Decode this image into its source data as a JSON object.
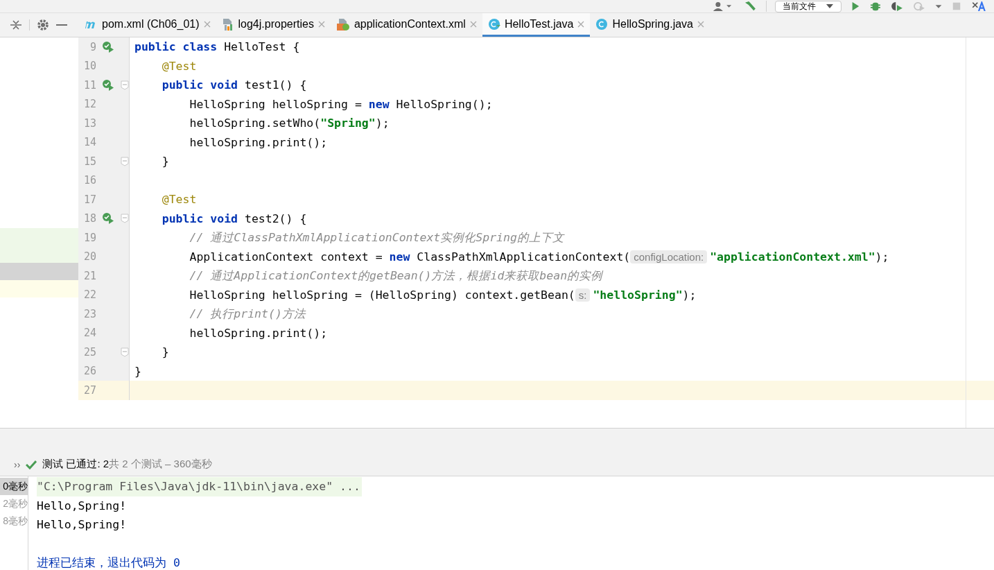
{
  "toolbar": {
    "run_config": "当前文件",
    "buttons": [
      {
        "kind": "user"
      },
      {
        "kind": "build"
      },
      {
        "kind": "config"
      },
      {
        "kind": "run",
        "disabled": false
      },
      {
        "kind": "debug",
        "disabled": false
      },
      {
        "kind": "coverage",
        "disabled": false
      },
      {
        "kind": "profile",
        "disabled": true
      },
      {
        "kind": "more"
      },
      {
        "kind": "stop",
        "disabled": true
      },
      {
        "kind": "translate"
      }
    ]
  },
  "tabs": [
    {
      "label": "pom.xml (Ch06_01)",
      "kind": "maven",
      "selected": false
    },
    {
      "label": "log4j.properties",
      "kind": "properties",
      "selected": false
    },
    {
      "label": "applicationContext.xml",
      "kind": "spring-xml",
      "selected": false
    },
    {
      "label": "HelloTest.java",
      "kind": "test-class",
      "selected": true
    },
    {
      "label": "HelloSpring.java",
      "kind": "class",
      "selected": false
    }
  ],
  "side_panel": {
    "rows": [
      {
        "kind": "passed"
      },
      {
        "kind": "passed"
      },
      {
        "kind": "selected"
      },
      {
        "kind": "current"
      }
    ]
  },
  "editor": {
    "lines": [
      {
        "number": "9",
        "run": true,
        "fold": false,
        "current": false,
        "tokens": [
          {
            "kind": "keyword",
            "text": "public class"
          },
          {
            "kind": "plain",
            "text": " HelloTest {"
          }
        ]
      },
      {
        "number": "10",
        "run": false,
        "fold": false,
        "current": false,
        "tokens": [
          {
            "kind": "annotation",
            "text": "    @Test"
          }
        ]
      },
      {
        "number": "11",
        "run": true,
        "fold": true,
        "current": false,
        "tokens": [
          {
            "kind": "keyword",
            "text": "    public void"
          },
          {
            "kind": "plain",
            "text": " test1() {"
          }
        ]
      },
      {
        "number": "12",
        "run": false,
        "fold": false,
        "current": false,
        "tokens": [
          {
            "kind": "plain",
            "text": "        HelloSpring helloSpring = "
          },
          {
            "kind": "keyword",
            "text": "new"
          },
          {
            "kind": "plain",
            "text": " HelloSpring();"
          }
        ]
      },
      {
        "number": "13",
        "run": false,
        "fold": false,
        "current": false,
        "tokens": [
          {
            "kind": "plain",
            "text": "        helloSpring.setWho("
          },
          {
            "kind": "string",
            "text": "\"Spring\""
          },
          {
            "kind": "plain",
            "text": ");"
          }
        ]
      },
      {
        "number": "14",
        "run": false,
        "fold": false,
        "current": false,
        "tokens": [
          {
            "kind": "plain",
            "text": "        helloSpring.print();"
          }
        ]
      },
      {
        "number": "15",
        "run": false,
        "fold": true,
        "current": false,
        "tokens": [
          {
            "kind": "plain",
            "text": "    }"
          }
        ]
      },
      {
        "number": "16",
        "run": false,
        "fold": false,
        "current": false
      },
      {
        "number": "17",
        "run": false,
        "fold": false,
        "current": false,
        "tokens": [
          {
            "kind": "annotation",
            "text": "    @Test"
          }
        ]
      },
      {
        "number": "18",
        "run": true,
        "fold": true,
        "current": false,
        "tokens": [
          {
            "kind": "keyword",
            "text": "    public void"
          },
          {
            "kind": "plain",
            "text": " test2() {"
          }
        ]
      },
      {
        "number": "19",
        "run": false,
        "fold": false,
        "current": false,
        "tokens": [
          {
            "kind": "comment",
            "text": "        // 通过ClassPathXmlApplicationContext实例化Spring的上下文"
          }
        ]
      },
      {
        "number": "20",
        "run": false,
        "fold": false,
        "current": false,
        "tokens": [
          {
            "kind": "plain",
            "text": "        ApplicationContext context = "
          },
          {
            "kind": "keyword",
            "text": "new"
          },
          {
            "kind": "plain",
            "text": " ClassPathXmlApplicationContext("
          },
          {
            "kind": "hint",
            "text": "configLocation:"
          },
          {
            "kind": "string",
            "text": "\"applicationContext.xml\""
          },
          {
            "kind": "plain",
            "text": ");"
          }
        ]
      },
      {
        "number": "21",
        "run": false,
        "fold": false,
        "current": false,
        "tokens": [
          {
            "kind": "comment",
            "text": "        // 通过ApplicationContext的getBean()方法，根据id来获取bean的实例"
          }
        ]
      },
      {
        "number": "22",
        "run": false,
        "fold": false,
        "current": false,
        "tokens": [
          {
            "kind": "plain",
            "text": "        HelloSpring helloSpring = (HelloSpring) context.getBean("
          },
          {
            "kind": "hint",
            "text": "s:"
          },
          {
            "kind": "string",
            "text": "\"helloSpring\""
          },
          {
            "kind": "plain",
            "text": ");"
          }
        ]
      },
      {
        "number": "23",
        "run": false,
        "fold": false,
        "current": false,
        "tokens": [
          {
            "kind": "comment",
            "text": "        // 执行print()方法"
          }
        ]
      },
      {
        "number": "24",
        "run": false,
        "fold": false,
        "current": false,
        "tokens": [
          {
            "kind": "plain",
            "text": "        helloSpring.print();"
          }
        ]
      },
      {
        "number": "25",
        "run": false,
        "fold": true,
        "current": false,
        "tokens": [
          {
            "kind": "plain",
            "text": "    }"
          }
        ]
      },
      {
        "number": "26",
        "run": false,
        "fold": false,
        "current": false,
        "tokens": [
          {
            "kind": "plain",
            "text": "}"
          }
        ]
      },
      {
        "number": "27",
        "run": false,
        "fold": false,
        "current": true
      }
    ]
  },
  "run_panel": {
    "expand": "››",
    "status_label": "测试 已通过: 2",
    "status_detail": "共 2 个测试 – 360毫秒",
    "passed": true,
    "times": [
      {
        "text": "0毫秒",
        "selected": true
      },
      {
        "text": "2毫秒",
        "selected": false
      },
      {
        "text": "8毫秒",
        "selected": false
      }
    ],
    "console": [
      {
        "kind": "command",
        "text": "\"C:\\Program Files\\Java\\jdk-11\\bin\\java.exe\" ..."
      },
      {
        "kind": "output",
        "text": "Hello,Spring!"
      },
      {
        "kind": "output",
        "text": "Hello,Spring!"
      },
      {
        "kind": "blank"
      },
      {
        "kind": "exit",
        "text": "进程已结束，退出代码为 0"
      }
    ]
  }
}
